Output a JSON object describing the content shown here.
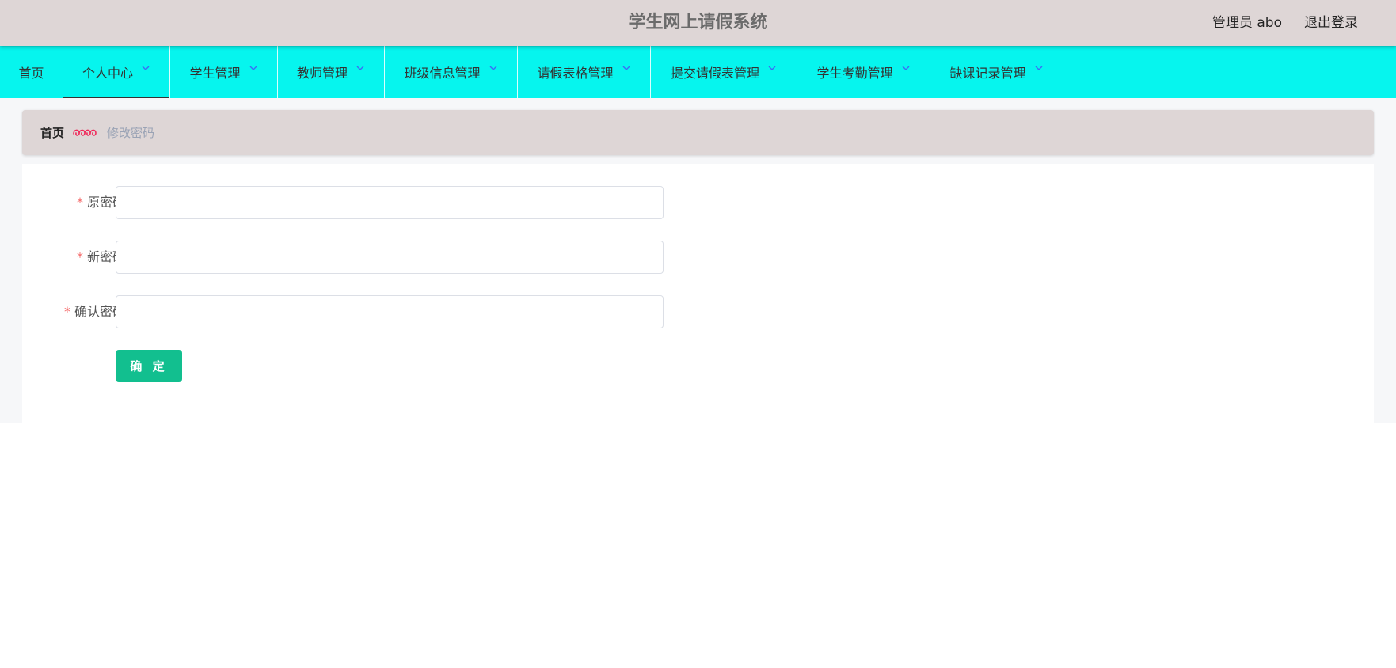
{
  "header": {
    "title": "学生网上请假系统",
    "user_label": "管理员 abo",
    "logout_label": "退出登录"
  },
  "nav": {
    "items": [
      {
        "label": "首页",
        "dropdown": false
      },
      {
        "label": "个人中心",
        "dropdown": true,
        "active": true
      },
      {
        "label": "学生管理",
        "dropdown": true
      },
      {
        "label": "教师管理",
        "dropdown": true
      },
      {
        "label": "班级信息管理",
        "dropdown": true
      },
      {
        "label": "请假表格管理",
        "dropdown": true
      },
      {
        "label": "提交请假表管理",
        "dropdown": true
      },
      {
        "label": "学生考勤管理",
        "dropdown": true
      },
      {
        "label": "缺课记录管理",
        "dropdown": true
      }
    ]
  },
  "breadcrumb": {
    "home": "首页",
    "separator_icon": "decorative-swirl-icon",
    "current": "修改密码"
  },
  "form": {
    "required_mark": "*",
    "fields": [
      {
        "label": "原密码",
        "value": "",
        "placeholder": ""
      },
      {
        "label": "新密码",
        "value": "",
        "placeholder": ""
      },
      {
        "label": "确认密码",
        "value": "",
        "placeholder": ""
      }
    ],
    "submit_label": "确 定"
  },
  "colors": {
    "header_bg": "#ded6d6",
    "nav_bg": "#06f5ee",
    "chevron": "#3b6cf5",
    "separator": "#f0295a",
    "submit_bg": "#12bf8f",
    "required": "#f56c6c"
  }
}
